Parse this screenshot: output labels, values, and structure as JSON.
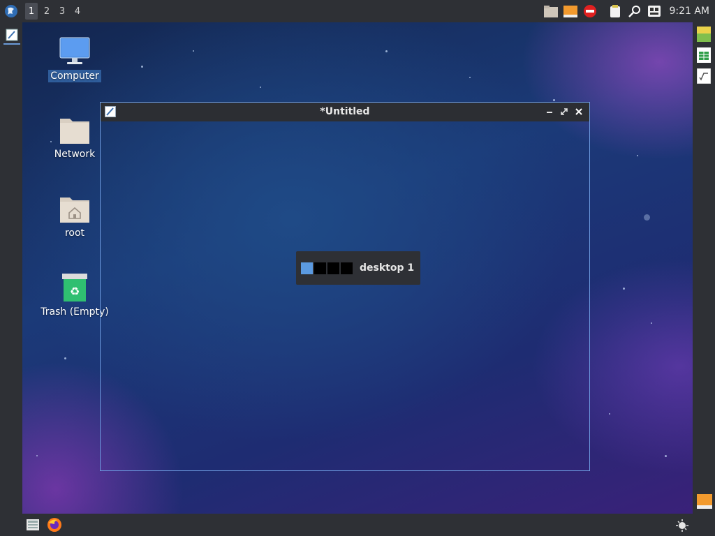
{
  "top_panel": {
    "workspaces": [
      "1",
      "2",
      "3",
      "4"
    ],
    "active_workspace": "1",
    "clock": "9:21 AM"
  },
  "desktop": {
    "icons": [
      {
        "label": "Computer",
        "icon": "computer-icon",
        "selected": true
      },
      {
        "label": "Network",
        "icon": "folder-icon"
      },
      {
        "label": "root",
        "icon": "home-folder-icon"
      },
      {
        "label": "Trash (Empty)",
        "icon": "trash-icon"
      }
    ]
  },
  "window": {
    "title": "*Untitled"
  },
  "pager_popup": {
    "label": "desktop 1"
  },
  "colors": {
    "accent": "#6d9be0",
    "panel": "#2e3035",
    "current_desktop": "#5b9ae0"
  }
}
